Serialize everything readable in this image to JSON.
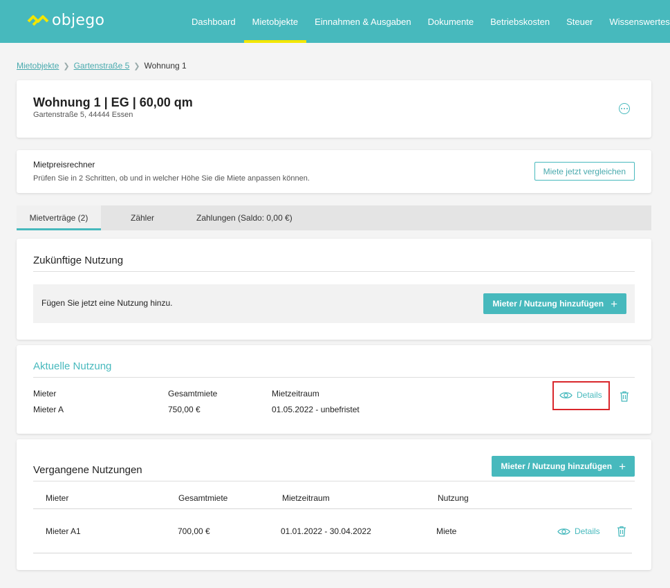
{
  "app": {
    "logo_text": "objego",
    "brand_color": "#47b9bd",
    "active_indicator_color": "#f3e600"
  },
  "nav": {
    "items": [
      {
        "label": "Dashboard"
      },
      {
        "label": "Mietobjekte"
      },
      {
        "label": "Einnahmen & Ausgaben"
      },
      {
        "label": "Dokumente"
      },
      {
        "label": "Betriebskosten"
      },
      {
        "label": "Steuer"
      },
      {
        "label": "Wissenswertes"
      }
    ],
    "active": "Mietobjekte"
  },
  "breadcrumb": {
    "items": [
      {
        "label": "Mietobjekte",
        "link": true
      },
      {
        "label": "Gartenstraße 5",
        "link": true
      },
      {
        "label": "Wohnung 1",
        "link": false
      }
    ]
  },
  "unit": {
    "title": "Wohnung 1 | EG | 60,00 qm",
    "address": "Gartenstraße 5, 44444 Essen"
  },
  "rent_calculator": {
    "title": "Mietpreisrechner",
    "description": "Prüfen Sie in 2 Schritten, ob und in welcher Höhe Sie die Miete anpassen können.",
    "button": "Miete jetzt vergleichen"
  },
  "tabs": {
    "items": [
      {
        "label": "Mietverträge (2)"
      },
      {
        "label": "Zähler"
      },
      {
        "label": "Zahlungen (Saldo: 0,00 €)"
      }
    ],
    "active": "Mietverträge (2)"
  },
  "future_usage": {
    "title": "Zukünftige Nutzung",
    "message": "Fügen Sie jetzt eine Nutzung hinzu.",
    "add_button": "Mieter / Nutzung hinzufügen",
    "add_icon": "+"
  },
  "current_usage": {
    "title": "Aktuelle Nutzung",
    "headers": {
      "tenant": "Mieter",
      "rent": "Gesamtmiete",
      "period": "Mietzeitraum"
    },
    "row": {
      "tenant": "Mieter A",
      "rent": "750,00 €",
      "period": "01.05.2022 - unbefristet"
    },
    "details_label": "Details",
    "highlight_color": "#d9262b"
  },
  "past_usage": {
    "title": "Vergangene Nutzungen",
    "add_button": "Mieter / Nutzung hinzufügen",
    "add_icon": "+",
    "headers": {
      "tenant": "Mieter",
      "rent": "Gesamtmiete",
      "period": "Mietzeitraum",
      "usage": "Nutzung"
    },
    "rows": [
      {
        "tenant": "Mieter A1",
        "rent": "700,00 €",
        "period": "01.01.2022 - 30.04.2022",
        "usage": "Miete",
        "details_label": "Details"
      }
    ]
  }
}
